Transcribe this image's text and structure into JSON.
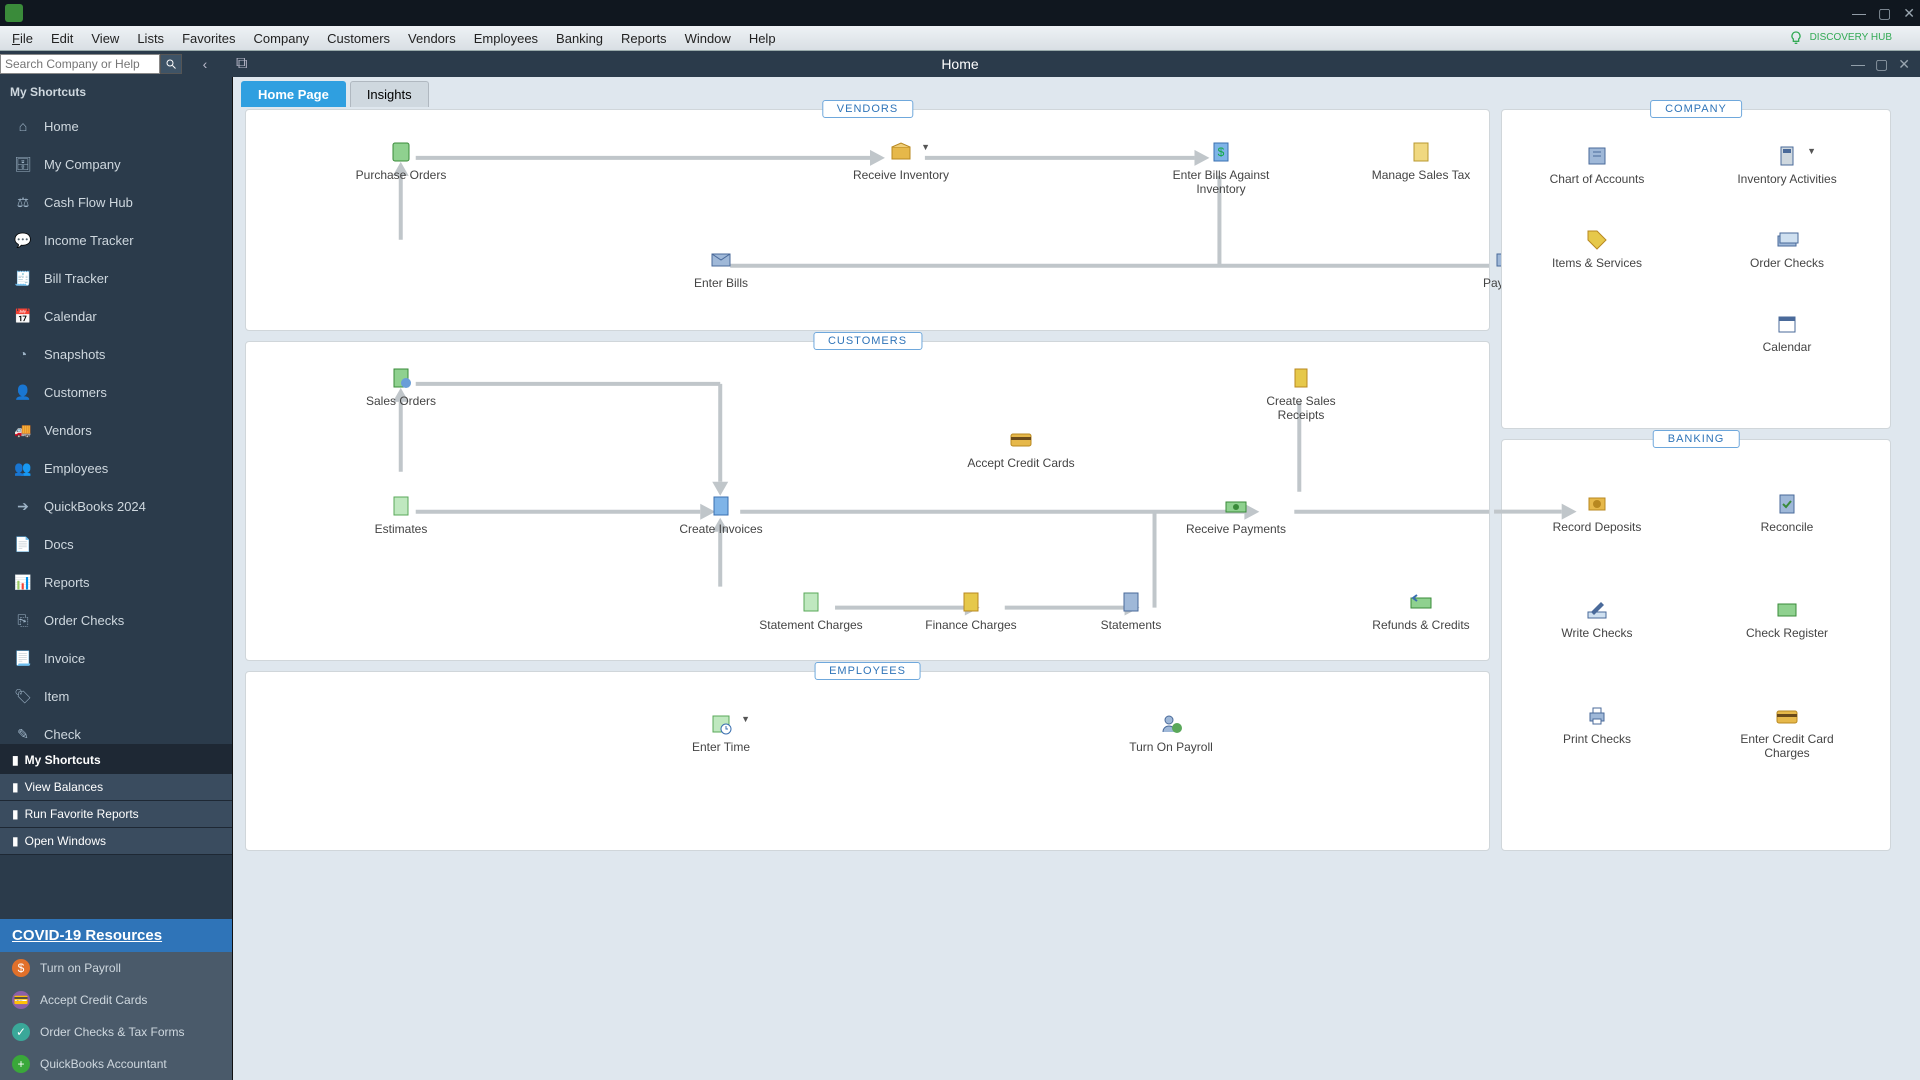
{
  "app": {
    "title": "Home",
    "search_placeholder": "Search Company or Help",
    "discovery": "DISCOVERY HUB"
  },
  "menubar": [
    "File",
    "Edit",
    "View",
    "Lists",
    "Favorites",
    "Company",
    "Customers",
    "Vendors",
    "Employees",
    "Banking",
    "Reports",
    "Window",
    "Help"
  ],
  "sidebar": {
    "heading": "My Shortcuts",
    "items": [
      {
        "label": "Home",
        "icon": "home"
      },
      {
        "label": "My Company",
        "icon": "briefcase"
      },
      {
        "label": "Cash Flow Hub",
        "icon": "scales"
      },
      {
        "label": "Income Tracker",
        "icon": "speech"
      },
      {
        "label": "Bill Tracker",
        "icon": "bill"
      },
      {
        "label": "Calendar",
        "icon": "calendar"
      },
      {
        "label": "Snapshots",
        "icon": "pie"
      },
      {
        "label": "Customers",
        "icon": "person"
      },
      {
        "label": "Vendors",
        "icon": "truck"
      },
      {
        "label": "Employees",
        "icon": "people"
      },
      {
        "label": "QuickBooks 2024",
        "icon": "arrow"
      },
      {
        "label": "Docs",
        "icon": "doc"
      },
      {
        "label": "Reports",
        "icon": "report"
      },
      {
        "label": "Order Checks",
        "icon": "checks"
      },
      {
        "label": "Invoice",
        "icon": "invoice"
      },
      {
        "label": "Item",
        "icon": "item"
      },
      {
        "label": "Check",
        "icon": "check"
      }
    ]
  },
  "bottom_tabs": [
    "My Shortcuts",
    "View Balances",
    "Run Favorite Reports",
    "Open Windows"
  ],
  "covid": {
    "link": "COVID-19 Resources"
  },
  "do_more": [
    {
      "label": "Turn on Payroll",
      "color": "#e0702a"
    },
    {
      "label": "Accept Credit Cards",
      "color": "#8b5fa8"
    },
    {
      "label": "Order Checks & Tax Forms",
      "color": "#3aa899"
    },
    {
      "label": "QuickBooks Accountant",
      "color": "#3aa83a"
    }
  ],
  "content_tabs": {
    "home": "Home Page",
    "insights": "Insights"
  },
  "sections": {
    "vendors": "VENDORS",
    "customers": "CUSTOMERS",
    "employees": "EMPLOYEES",
    "company": "COMPANY",
    "banking": "BANKING"
  },
  "nodes": {
    "vendors": {
      "purchase_orders": "Purchase Orders",
      "receive_inventory": "Receive Inventory",
      "enter_bills_inventory": "Enter Bills Against Inventory",
      "manage_sales_tax": "Manage Sales Tax",
      "enter_bills": "Enter Bills",
      "pay_bills": "Pay Bills"
    },
    "customers": {
      "sales_orders": "Sales Orders",
      "accept_cc": "Accept Credit Cards",
      "create_sales_receipts": "Create Sales Receipts",
      "estimates": "Estimates",
      "create_invoices": "Create Invoices",
      "receive_payments": "Receive Payments",
      "statement_charges": "Statement Charges",
      "finance_charges": "Finance Charges",
      "statements": "Statements",
      "refunds_credits": "Refunds & Credits"
    },
    "employees": {
      "enter_time": "Enter Time",
      "turn_on_payroll": "Turn On Payroll"
    },
    "company": {
      "chart_accounts": "Chart of Accounts",
      "inventory_activities": "Inventory Activities",
      "items_services": "Items & Services",
      "order_checks": "Order Checks",
      "calendar": "Calendar"
    },
    "banking": {
      "record_deposits": "Record Deposits",
      "reconcile": "Reconcile",
      "write_checks": "Write Checks",
      "check_register": "Check Register",
      "print_checks": "Print Checks",
      "enter_cc_charges": "Enter Credit Card Charges"
    }
  }
}
